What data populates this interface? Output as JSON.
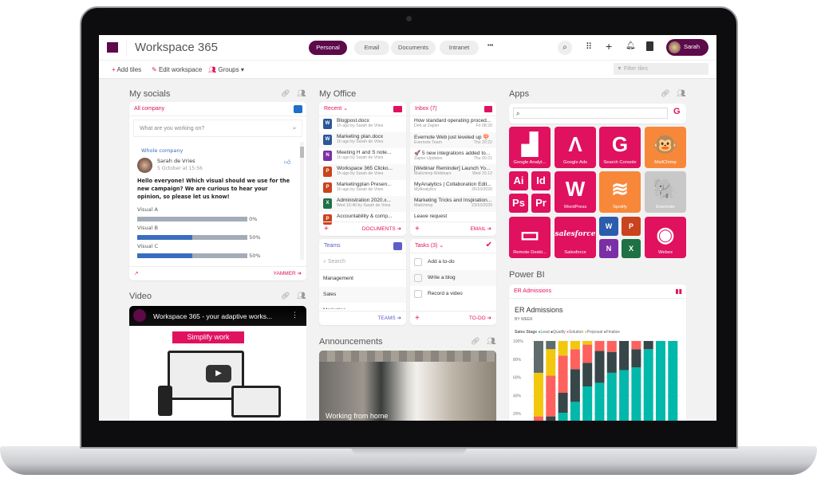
{
  "app": {
    "title": "Workspace 365"
  },
  "header": {
    "tabs": [
      {
        "label": "Personal",
        "active": true
      },
      {
        "label": "Email"
      },
      {
        "label": "Documents"
      },
      {
        "label": "Intranet"
      }
    ],
    "more": "•••",
    "user": "Sarah",
    "icons": [
      "search-icon",
      "apps-grid-icon",
      "plus-icon",
      "bell-icon",
      "contacts-icon"
    ]
  },
  "toolbar": {
    "add_tiles": "Add tiles",
    "edit_workspace": "Edit workspace",
    "groups": "Groups",
    "filter_placeholder": "Filter tiles"
  },
  "socials": {
    "title": "My socials",
    "tab": "All company",
    "compose_placeholder": "What are you working on?",
    "group": "Whole company",
    "author": "Sarah de Vries",
    "time": "5 October at 15:56",
    "message": "Hello everyone! Which visual should we use for the new campaign? We are curious to hear your opinion, so please let us know!",
    "poll": [
      {
        "label": "Visual A",
        "pct": 0,
        "text": "0%"
      },
      {
        "label": "Visual B",
        "pct": 50,
        "text": "50%"
      },
      {
        "label": "Visual C",
        "pct": 50,
        "text": "50%"
      }
    ],
    "footer": "YAMMER"
  },
  "video": {
    "title": "Video",
    "video_title": "Workspace 365 - your adaptive works...",
    "banner": "Simplify work"
  },
  "office": {
    "title": "My Office",
    "recent": {
      "label": "Recent",
      "footer": "DOCUMENTS",
      "files": [
        {
          "name": "Blogpost.docx",
          "meta": "1h ago by Sarah de Vries",
          "type": "W",
          "color": "#2b5797"
        },
        {
          "name": "Marketing plan.docx",
          "meta": "1h ago by Sarah de Vries",
          "type": "W",
          "color": "#2b5797"
        },
        {
          "name": "Meeting H and S note...",
          "meta": "1h ago by Sarah de Vries",
          "type": "N",
          "color": "#7b2fa6"
        },
        {
          "name": "Workspace 365 Clicko...",
          "meta": "1h ago by Sarah de Vries",
          "type": "P",
          "color": "#c9431e"
        },
        {
          "name": "Marketingplan Presen...",
          "meta": "1h ago by Sarah de Vries",
          "type": "P",
          "color": "#c9431e"
        },
        {
          "name": "Administration 2020.x...",
          "meta": "Wed 16:40 by Sarah de Vries",
          "type": "X",
          "color": "#1e7145"
        },
        {
          "name": "Accountability & comp...",
          "meta": "",
          "type": "P",
          "color": "#c9431e"
        }
      ]
    },
    "inbox": {
      "label": "Inbox (7)",
      "footer": "EMAIL",
      "mails": [
        {
          "subject": "How standard operating proced...",
          "from": "Deb at Zapier",
          "date": "Fri 08:20"
        },
        {
          "subject": "Evernote Web just leveled up 🍄",
          "from": "Evernote Team",
          "date": "Thu 20:22"
        },
        {
          "subject": "🚀 5 new integrations added to...",
          "from": "Zapier Updates",
          "date": "Thu 00:21"
        },
        {
          "subject": "[Webinar Reminder] Launch Yo...",
          "from": "Mailchimp Webinars",
          "date": "Wed 15:12"
        },
        {
          "subject": "MyAnalytics | Collaboration Edit...",
          "from": "MyAnalytics",
          "date": "26/10/2020"
        },
        {
          "subject": "Marketing Tricks and Inspiration...",
          "from": "Mailchimp",
          "date": "23/10/2020"
        },
        {
          "subject": "Leave request",
          "from": "",
          "date": ""
        }
      ]
    },
    "teams": {
      "label": "Teams",
      "search_placeholder": "Search",
      "items": [
        "Management",
        "Sales",
        "Marketing"
      ],
      "footer": "TEAMS"
    },
    "tasks": {
      "label": "Tasks (3)",
      "items": [
        "Add a to-do",
        "Write a blog",
        "Record a video"
      ],
      "footer": "TO-DO"
    }
  },
  "announcements": {
    "title": "Announcements",
    "caption": "Working from home"
  },
  "apps": {
    "title": "Apps",
    "items": [
      {
        "label": "Google Analyt...",
        "glyph": "▟",
        "color": "#e0115f"
      },
      {
        "label": "Google Ads",
        "glyph": "Λ",
        "color": "#e0115f"
      },
      {
        "label": "Search Console",
        "glyph": "G",
        "color": "#e0115f"
      },
      {
        "label": "MailChimp",
        "glyph": "🐵",
        "color": "#f7883a"
      },
      {
        "label": "WordPress",
        "glyph": "W",
        "color": "#e0115f"
      },
      {
        "label": "Spotify",
        "glyph": "≋",
        "color": "#f7883a"
      },
      {
        "label": "Evernote",
        "glyph": "🐘",
        "color": "#c8c8c8"
      },
      {
        "label": "Remote Deskt...",
        "glyph": "▭",
        "color": "#e0115f"
      },
      {
        "label": "Salesforce",
        "glyph": "salesforce",
        "color": "#e0115f"
      },
      {
        "label": "Webex",
        "glyph": "◉",
        "color": "#e0115f"
      }
    ],
    "adobe": [
      "Ai",
      "Id",
      "Ps",
      "Pr"
    ],
    "office": [
      {
        "l": "W",
        "c": "#2b5cad"
      },
      {
        "l": "P",
        "c": "#c9431e"
      },
      {
        "l": "N",
        "c": "#7b2fa6"
      },
      {
        "l": "X",
        "c": "#1e7145"
      }
    ]
  },
  "powerbi": {
    "title": "Power BI",
    "tile_label": "ER Admissions",
    "chart_data": {
      "type": "bar",
      "stacked": true,
      "title": "ER Admissions",
      "subtitle": "BY WEEK",
      "legend_title": "Sales Stage",
      "legend_position": "top-left",
      "yticks": [
        "100%",
        "80%",
        "60%",
        "40%",
        "20%"
      ],
      "ylim": [
        0,
        100
      ],
      "series": [
        {
          "name": "Lead",
          "color": "#01b8aa",
          "values": [
            0,
            10,
            21,
            33,
            50,
            54,
            65,
            68,
            71,
            91,
            100,
            100
          ]
        },
        {
          "name": "Qualify",
          "color": "#374649",
          "values": [
            0,
            7,
            22,
            36,
            26,
            35,
            23,
            32,
            20,
            9,
            0,
            0
          ]
        },
        {
          "name": "Solution",
          "color": "#fd625e",
          "values": [
            17,
            45,
            41,
            22,
            20,
            11,
            12,
            0,
            9,
            0,
            0,
            0
          ]
        },
        {
          "name": "Proposal",
          "color": "#f2c80f",
          "values": [
            48,
            29,
            16,
            9,
            4,
            0,
            0,
            0,
            0,
            0,
            0,
            0
          ]
        },
        {
          "name": "Finalize",
          "color": "#5f6b6d",
          "values": [
            35,
            9,
            0,
            0,
            0,
            0,
            0,
            0,
            0,
            0,
            0,
            0
          ]
        }
      ]
    }
  },
  "colors": {
    "brand": "#5c0a4a",
    "accent": "#e0115f"
  }
}
